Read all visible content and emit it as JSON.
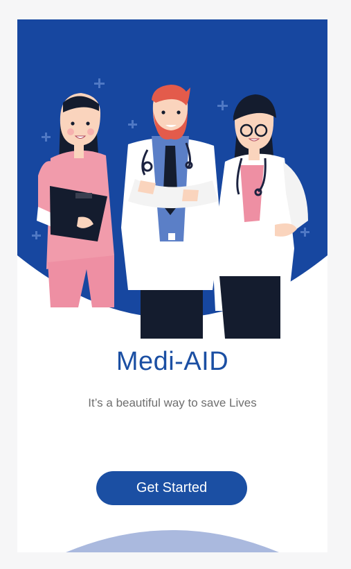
{
  "app": {
    "title": "Medi-AID",
    "tagline": "It’s a beautiful way to save Lives",
    "get_started_label": "Get Started"
  },
  "colors": {
    "primary": "#1b4fa3",
    "hero_bg": "#1747a0",
    "bottom_arc": "#aab9de",
    "subtitle": "#6e6e6e"
  },
  "illustration": {
    "name": "three-doctors-illustration",
    "figures": [
      "nurse-figure",
      "male-doctor-figure",
      "female-doctor-figure"
    ]
  }
}
